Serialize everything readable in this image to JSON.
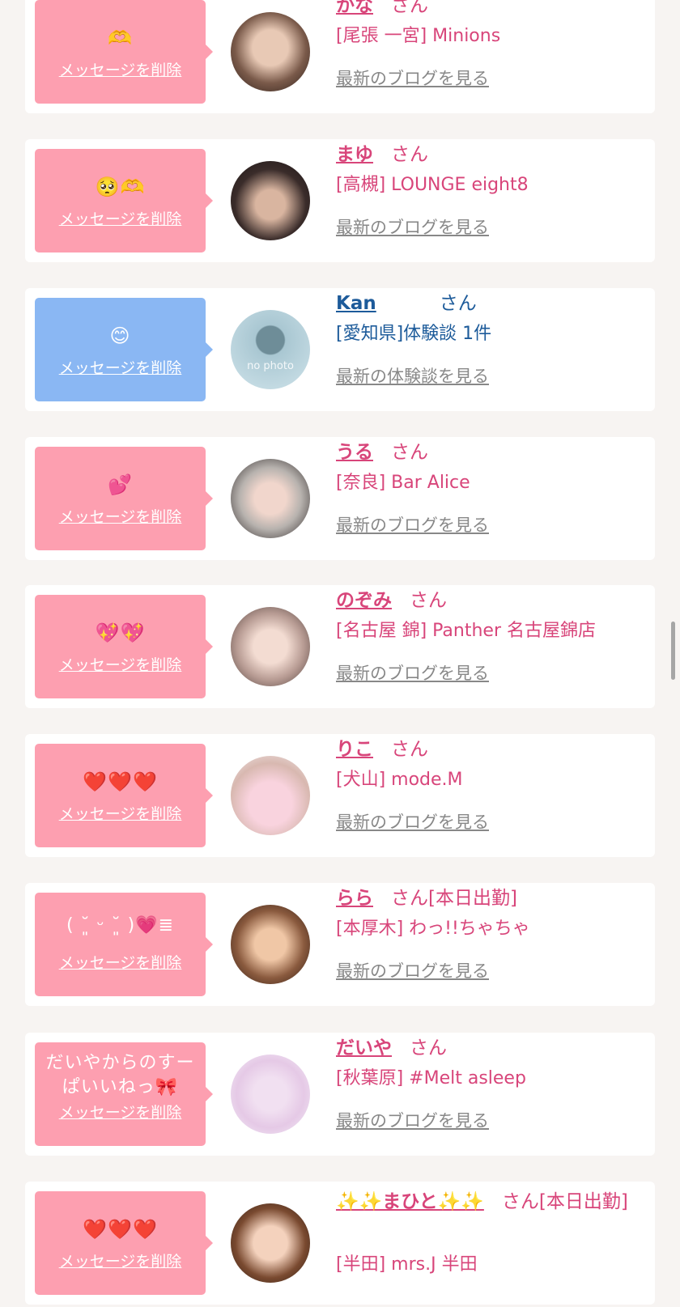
{
  "suffix": "さん",
  "colors": {
    "pink_bubble": "#fd9fb0",
    "blue_bubble": "#8ab7f3",
    "pink_text": "#d8457a",
    "blue_text": "#1d5b9a"
  },
  "messages": [
    {
      "message": "🫶",
      "delete_label": "メッセージを削除",
      "name": "かな",
      "status": "",
      "shop": "[尾張 一宮] Minions",
      "blog_link": "最新のブログを見る",
      "bubble": "pink"
    },
    {
      "message": "🥺🫶",
      "delete_label": "メッセージを削除",
      "name": "まゆ",
      "status": "",
      "shop": "[高槻] LOUNGE eight8",
      "blog_link": "最新のブログを見る",
      "bubble": "pink"
    },
    {
      "message": "😊",
      "delete_label": "メッセージを削除",
      "name": "Kan",
      "status": "",
      "shop": "[愛知県]体験談 1件",
      "blog_link": "最新の体験談を見る",
      "bubble": "blue",
      "avatar_text": "no photo"
    },
    {
      "message": "💕",
      "delete_label": "メッセージを削除",
      "name": "うる",
      "status": "",
      "shop": "[奈良] Bar Alice",
      "blog_link": "最新のブログを見る",
      "bubble": "pink"
    },
    {
      "message": "💖💖",
      "delete_label": "メッセージを削除",
      "name": "のぞみ",
      "status": "",
      "shop": "[名古屋 錦] Panther 名古屋錦店",
      "blog_link": "最新のブログを見る",
      "bubble": "pink"
    },
    {
      "message": "❤️❤️❤️",
      "delete_label": "メッセージを削除",
      "name": "りこ",
      "status": "",
      "shop": "[犬山] mode.M",
      "blog_link": "最新のブログを見る",
      "bubble": "pink"
    },
    {
      "message": "( ˘͈ ᵕ ˘͈ )💗≣",
      "delete_label": "メッセージを削除",
      "name": "らら",
      "status": "[本日出勤]",
      "shop": "[本厚木] わっ!!ちゃちゃ",
      "blog_link": "最新のブログを見る",
      "bubble": "pink"
    },
    {
      "message": "だいやからのすーぱいいねっ🎀",
      "delete_label": "メッセージを削除",
      "name": "だいや",
      "status": "",
      "shop": "[秋葉原] #Melt asleep",
      "blog_link": "最新のブログを見る",
      "bubble": "pink"
    },
    {
      "message": "❤️❤️❤️",
      "delete_label": "メッセージを削除",
      "name": "✨✨まひと✨✨",
      "status": "[本日出勤]",
      "shop": "[半田] mrs.J 半田",
      "blog_link": "",
      "bubble": "pink"
    }
  ]
}
